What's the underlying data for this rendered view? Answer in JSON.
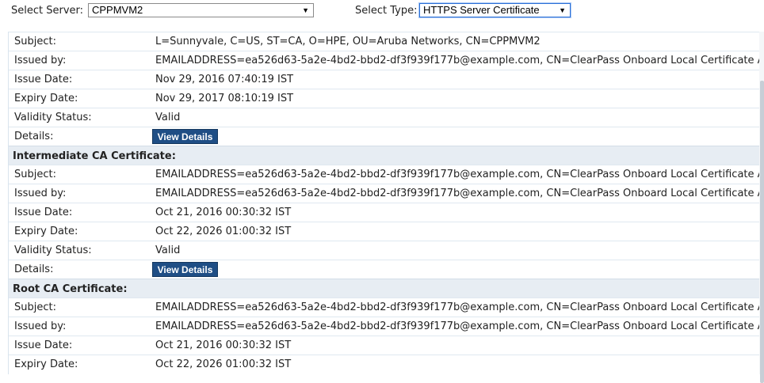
{
  "header": {
    "server_label": "Select Server:",
    "server_value": "CPPMVM2",
    "type_label": "Select Type:",
    "type_value": "HTTPS Server Certificate"
  },
  "view_details_label": "View Details",
  "server_certificate": {
    "rows": [
      {
        "key": "Subject:",
        "value": "L=Sunnyvale, C=US, ST=CA, O=HPE, OU=Aruba Networks, CN=CPPMVM2"
      },
      {
        "key": "Issued by:",
        "value": "EMAILADDRESS=ea526d63-5a2e-4bd2-bbd2-df3f939f177b@example.com, CN=ClearPass Onboard Local Certificate Auth"
      },
      {
        "key": "Issue Date:",
        "value": "Nov 29, 2016 07:40:19 IST"
      },
      {
        "key": "Expiry Date:",
        "value": "Nov 29, 2017 08:10:19 IST"
      },
      {
        "key": "Validity Status:",
        "value": "Valid"
      },
      {
        "key": "Details:",
        "value": ""
      }
    ]
  },
  "intermediate_ca": {
    "title": "Intermediate CA Certificate:",
    "rows": [
      {
        "key": "Subject:",
        "value": "EMAILADDRESS=ea526d63-5a2e-4bd2-bbd2-df3f939f177b@example.com, CN=ClearPass Onboard Local Certificate Auth"
      },
      {
        "key": "Issued by:",
        "value": "EMAILADDRESS=ea526d63-5a2e-4bd2-bbd2-df3f939f177b@example.com, CN=ClearPass Onboard Local Certificate Auth"
      },
      {
        "key": "Issue Date:",
        "value": "Oct 21, 2016 00:30:32 IST"
      },
      {
        "key": "Expiry Date:",
        "value": "Oct 22, 2026 01:00:32 IST"
      },
      {
        "key": "Validity Status:",
        "value": "Valid"
      },
      {
        "key": "Details:",
        "value": ""
      }
    ]
  },
  "root_ca": {
    "title": "Root CA Certificate:",
    "rows": [
      {
        "key": "Subject:",
        "value": "EMAILADDRESS=ea526d63-5a2e-4bd2-bbd2-df3f939f177b@example.com, CN=ClearPass Onboard Local Certificate Auth"
      },
      {
        "key": "Issued by:",
        "value": "EMAILADDRESS=ea526d63-5a2e-4bd2-bbd2-df3f939f177b@example.com, CN=ClearPass Onboard Local Certificate Auth"
      },
      {
        "key": "Issue Date:",
        "value": "Oct 21, 2016 00:30:32 IST"
      },
      {
        "key": "Expiry Date:",
        "value": "Oct 22, 2026 01:00:32 IST"
      }
    ]
  }
}
